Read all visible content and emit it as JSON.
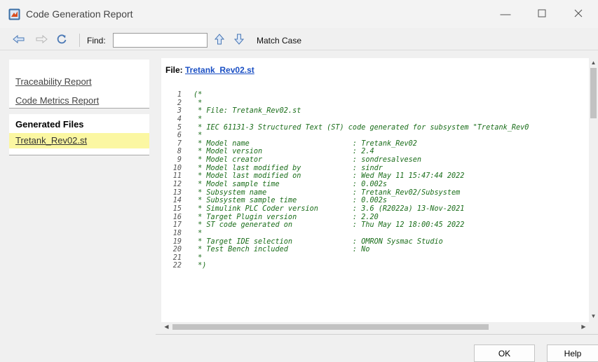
{
  "window": {
    "title": "Code Generation Report",
    "minimize_icon": "minimize-icon",
    "maximize_icon": "maximize-icon",
    "close_icon": "close-icon"
  },
  "toolbar": {
    "back_icon": "back-arrow-icon",
    "forward_icon": "forward-arrow-icon",
    "refresh_icon": "refresh-icon",
    "find_label": "Find:",
    "find_value": "",
    "find_placeholder": "",
    "find_prev_icon": "arrow-up-icon",
    "find_next_icon": "arrow-down-icon",
    "match_case_label": "Match Case"
  },
  "sidebar": {
    "links": [
      "Traceability Report",
      "Code Metrics Report"
    ],
    "section_title": "Generated Files",
    "files": [
      "Tretank_Rev02.st"
    ]
  },
  "main": {
    "file_label": "File:",
    "file_link": "Tretank_Rev02.st",
    "code_lines": [
      {
        "n": "1",
        "text": "(*"
      },
      {
        "n": "2",
        "text": " *"
      },
      {
        "n": "3",
        "text": " * File: Tretank_Rev02.st"
      },
      {
        "n": "4",
        "text": " *"
      },
      {
        "n": "5",
        "text": " * IEC 61131-3 Structured Text (ST) code generated for subsystem \"Tretank_Rev0"
      },
      {
        "n": "6",
        "text": " *"
      },
      {
        "n": "7",
        "text": " * Model name                        : Tretank_Rev02"
      },
      {
        "n": "8",
        "text": " * Model version                     : 2.4"
      },
      {
        "n": "9",
        "text": " * Model creator                     : sondresalvesen"
      },
      {
        "n": "10",
        "text": " * Model last modified by            : sindr"
      },
      {
        "n": "11",
        "text": " * Model last modified on            : Wed May 11 15:47:44 2022"
      },
      {
        "n": "12",
        "text": " * Model sample time                 : 0.002s"
      },
      {
        "n": "13",
        "text": " * Subsystem name                    : Tretank_Rev02/Subsystem"
      },
      {
        "n": "14",
        "text": " * Subsystem sample time             : 0.002s"
      },
      {
        "n": "15",
        "text": " * Simulink PLC Coder version        : 3.6 (R2022a) 13-Nov-2021"
      },
      {
        "n": "16",
        "text": " * Target Plugin version             : 2.20"
      },
      {
        "n": "17",
        "text": " * ST code generated on              : Thu May 12 18:00:45 2022"
      },
      {
        "n": "18",
        "text": " *"
      },
      {
        "n": "19",
        "text": " * Target IDE selection              : OMRON Sysmac Studio"
      },
      {
        "n": "20",
        "text": " * Test Bench included               : No"
      },
      {
        "n": "21",
        "text": " *"
      },
      {
        "n": "22",
        "text": " *)"
      }
    ]
  },
  "buttons": {
    "ok": "OK",
    "help": "Help"
  },
  "colors": {
    "highlight": "#fbf7a2",
    "link": "#1a4fc4",
    "comment": "#1a6d1a"
  }
}
